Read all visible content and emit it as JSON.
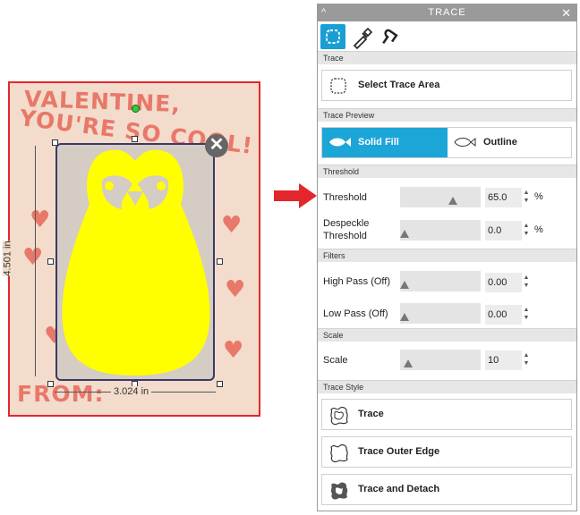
{
  "card": {
    "line1": "VALENTINE,",
    "line2": "YOU'RE SO COOL!",
    "from": "FROM:",
    "height_label": "4.501 in",
    "width_label": "3.024 in",
    "close_glyph": "✕"
  },
  "panel": {
    "title": "TRACE",
    "collapse_glyph": "^",
    "close_glyph": "✕",
    "toolbar_icons": [
      "trace-icon",
      "eyedropper-icon",
      "magnet-icon"
    ],
    "sections": {
      "trace": "Trace",
      "trace_preview": "Trace Preview",
      "threshold": "Threshold",
      "filters": "Filters",
      "scale": "Scale",
      "trace_style": "Trace Style"
    },
    "select_trace_area": "Select Trace Area",
    "preview": {
      "solid_fill": "Solid Fill",
      "outline": "Outline",
      "active": "Solid Fill"
    },
    "threshold": {
      "label": "Threshold",
      "value": "65.0",
      "unit": "%",
      "level": 0.65
    },
    "despeckle": {
      "label_line1": "Despeckle",
      "label_line2": "Threshold",
      "value": "0.0",
      "unit": "%",
      "level": 0.0
    },
    "high_pass": {
      "label": "High Pass (Off)",
      "value": "0.00",
      "level": 0.0
    },
    "low_pass": {
      "label": "Low Pass (Off)",
      "value": "0.00",
      "level": 0.0
    },
    "scale": {
      "label": "Scale",
      "value": "10",
      "level": 0.1
    },
    "trace_style": {
      "trace": "Trace",
      "trace_outer_edge": "Trace Outer Edge",
      "trace_and_detach": "Trace and Detach"
    }
  },
  "colors": {
    "accent": "#1ca6d8",
    "arrow": "#e3262b",
    "penguin": "#ffff00",
    "card_bg": "#f3dccb",
    "lettering": "#e8786a"
  }
}
